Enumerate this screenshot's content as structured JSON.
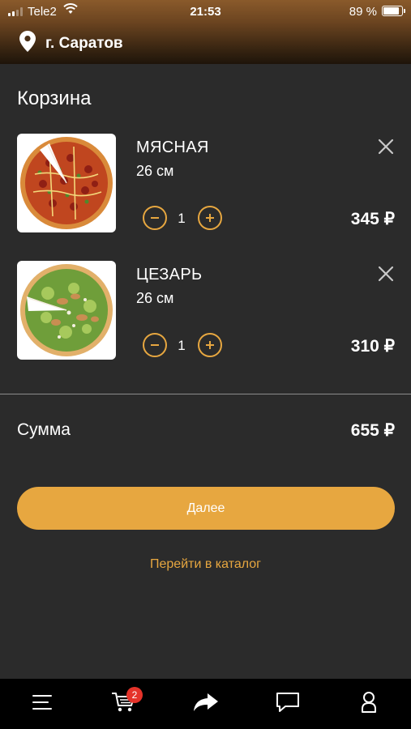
{
  "status_bar": {
    "carrier": "Tele2",
    "time": "21:53",
    "battery": "89 %"
  },
  "header": {
    "city": "г. Саратов"
  },
  "page": {
    "title": "Корзина"
  },
  "cart": {
    "items": [
      {
        "name": "МЯСНАЯ",
        "size": "26 см",
        "quantity": "1",
        "price": "345 ₽"
      },
      {
        "name": "ЦЕЗАРЬ",
        "size": "26 см",
        "quantity": "1",
        "price": "310 ₽"
      }
    ],
    "sum_label": "Сумма",
    "sum_value": "655 ₽"
  },
  "actions": {
    "next_label": "Далее",
    "catalog_label": "Перейти в каталог"
  },
  "tabbar": {
    "items": [
      {
        "icon": "menu-icon"
      },
      {
        "icon": "cart-icon",
        "badge": "2"
      },
      {
        "icon": "share-icon"
      },
      {
        "icon": "chat-icon"
      },
      {
        "icon": "profile-icon"
      }
    ]
  },
  "colors": {
    "accent": "#e7a740",
    "background": "#2b2b2b",
    "badge": "#e5332a"
  }
}
